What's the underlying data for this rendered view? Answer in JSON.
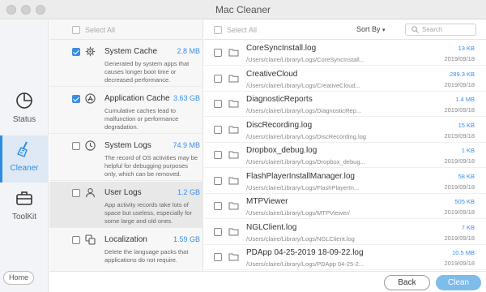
{
  "window": {
    "title": "Mac Cleaner"
  },
  "nav": {
    "items": [
      {
        "label": "Status",
        "icon": "pie-chart-icon",
        "active": false
      },
      {
        "label": "Cleaner",
        "icon": "broom-icon",
        "active": true
      },
      {
        "label": "ToolKit",
        "icon": "toolbox-icon",
        "active": false
      }
    ],
    "home_label": "Home"
  },
  "categories": {
    "select_all_label": "Select All",
    "items": [
      {
        "name": "System Cache",
        "size": "2.8 MB",
        "desc": "Generated by system apps that causes longer boot time or decreased performance.",
        "checked": true,
        "icon": "gear-icon"
      },
      {
        "name": "Application Cache",
        "size": "3.63 GB",
        "desc": "Cumulative caches lead to malfunction or performance degradation.",
        "checked": true,
        "icon": "app-store-icon"
      },
      {
        "name": "System Logs",
        "size": "74.9 MB",
        "desc": "The record of OS activities may be helpful for debugging purposes only, which can be removed.",
        "checked": false,
        "icon": "clock-icon"
      },
      {
        "name": "User Logs",
        "size": "1.2 GB",
        "desc": "App activity records take lots of space but useless, especially for some large and old ones.",
        "checked": false,
        "icon": "user-icon"
      },
      {
        "name": "Localization",
        "size": "1.59 GB",
        "desc": "Delete the language packs that applications do not require.",
        "checked": false,
        "icon": "language-icon"
      }
    ]
  },
  "files": {
    "select_all_label": "Select All",
    "sort_label": "Sort By",
    "search_placeholder": "Search",
    "rows": [
      {
        "name": "CoreSyncInstall.log",
        "path": "/Users/claire/Library/Logs/CoreSyncInstall...",
        "size": "13 KB",
        "date": "2019/09/18"
      },
      {
        "name": "CreativeCloud",
        "path": "/Users/claire/Library/Logs/CreativeCloud...",
        "size": "289.3 KB",
        "date": "2019/09/18"
      },
      {
        "name": "DiagnosticReports",
        "path": "/Users/claire/Library/Logs/DiagnosticRep...",
        "size": "1.4 MB",
        "date": "2019/09/18"
      },
      {
        "name": "DiscRecording.log",
        "path": "/Users/claire/Library/Logs/DiscRecording.log",
        "size": "15 KB",
        "date": "2019/09/18"
      },
      {
        "name": "Dropbox_debug.log",
        "path": "/Users/claire/Library/Logs/Dropbox_debug...",
        "size": "1 KB",
        "date": "2019/09/18"
      },
      {
        "name": "FlashPlayerInstallManager.log",
        "path": "/Users/claire/Library/Logs/FlashPlayerIn...",
        "size": "58 KB",
        "date": "2019/09/18"
      },
      {
        "name": "MTPViewer",
        "path": "/Users/claire/Library/Logs/MTPViewer/",
        "size": "505 KB",
        "date": "2019/09/18"
      },
      {
        "name": "NGLClient.log",
        "path": "/Users/claire/Library/Logs/NGLClient.log",
        "size": "7 KB",
        "date": "2019/09/18"
      },
      {
        "name": "PDApp 04-25-2019 18-09-22.log",
        "path": "/Users/claire/Library/Logs/PDApp 04-25-2...",
        "size": "10.5 MB",
        "date": "2019/09/18"
      }
    ]
  },
  "footer": {
    "back_label": "Back",
    "clean_label": "Clean"
  },
  "colors": {
    "accent": "#3a8ee6",
    "clean_button": "#7ebcec",
    "nav_active_bg": "#dfe9f5"
  }
}
